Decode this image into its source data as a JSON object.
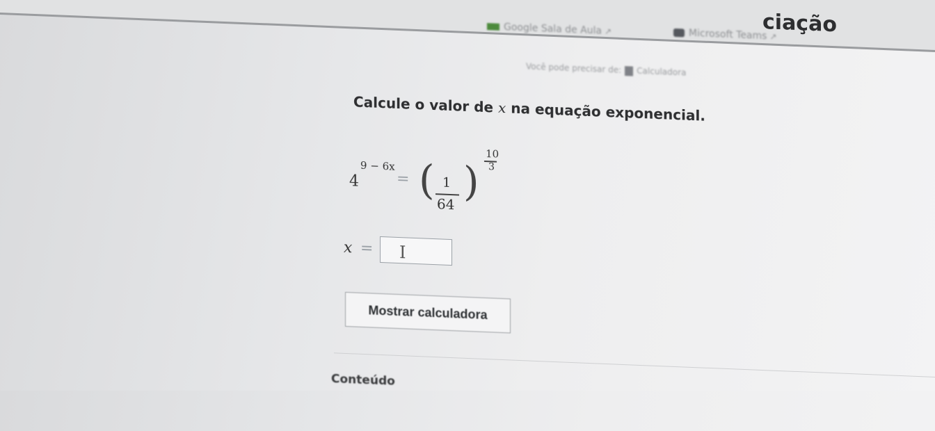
{
  "header": {
    "links": [
      {
        "label": "Google Sala de Aula",
        "icon": "google-classroom-icon",
        "external": "↗"
      },
      {
        "label": "Microsoft Teams",
        "icon": "microsoft-teams-icon",
        "external": "↗"
      }
    ],
    "heading_fragment": "ciação"
  },
  "hint": {
    "prefix": "Você pode precisar de:",
    "tool": "Calculadora",
    "icon": "calculator-icon"
  },
  "question": {
    "before": "Calcule o valor de",
    "variable": "x",
    "after": "na equação exponencial."
  },
  "equation": {
    "base": "4",
    "exponent": "9 − 6x",
    "equals": "=",
    "fraction_numerator": "1",
    "fraction_denominator": "64",
    "power_numerator": "10",
    "power_denominator": "3"
  },
  "answer": {
    "variable": "x",
    "equals": "=",
    "value": "",
    "cursor": "I"
  },
  "calculator_button": {
    "label": "Mostrar calculadora"
  },
  "footer": {
    "text": "Conteúdo"
  }
}
